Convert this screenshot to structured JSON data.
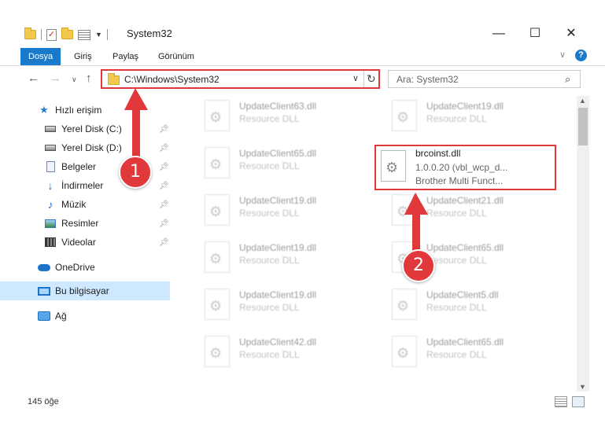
{
  "window": {
    "title": "System32",
    "minimize": "—",
    "maximize": "☐",
    "close": "✕"
  },
  "ribbon": {
    "tabs": [
      "Dosya",
      "Giriş",
      "Paylaş",
      "Görünüm"
    ],
    "active_tab": "Dosya",
    "help": "?"
  },
  "address": {
    "path": "C:\\Windows\\System32",
    "search_placeholder": "Ara: System32"
  },
  "sidebar": {
    "quick_access": "Hızlı erişim",
    "items": [
      {
        "label": "Yerel Disk (C:)",
        "icon": "drive-icon"
      },
      {
        "label": "Yerel Disk (D:)",
        "icon": "drive-icon"
      },
      {
        "label": "Belgeler",
        "icon": "documents-icon"
      },
      {
        "label": "İndirmeler",
        "icon": "downloads-icon"
      },
      {
        "label": "Müzik",
        "icon": "music-icon"
      },
      {
        "label": "Resimler",
        "icon": "pictures-icon"
      },
      {
        "label": "Videolar",
        "icon": "videos-icon"
      }
    ],
    "onedrive": "OneDrive",
    "this_pc": "Bu bilgisayar",
    "network": "Ağ"
  },
  "files": {
    "left_column": [
      {
        "name": "UpdateClient63.dll",
        "type": "Resource DLL"
      },
      {
        "name": "UpdateClient65.dll",
        "type": "Resource DLL"
      },
      {
        "name": "UpdateClient19.dll",
        "type": "Resource DLL"
      },
      {
        "name": "UpdateClient19.dll",
        "type": "Resource DLL"
      },
      {
        "name": "UpdateClient19.dll",
        "type": "Resource DLL"
      },
      {
        "name": "UpdateClient42.dll",
        "type": "Resource DLL"
      }
    ],
    "right_column": [
      {
        "name": "UpdateClient19.dll",
        "type": "Resource DLL"
      },
      {
        "name": "brcoinst.dll",
        "version": "1.0.0.20 (vbl_wcp_d...",
        "type": "Brother Multi Funct..."
      },
      {
        "name": "UpdateClient21.dll",
        "type": "Resource DLL"
      },
      {
        "name": "UpdateClient65.dll",
        "type": "Resource DLL"
      },
      {
        "name": "UpdateClient5.dll",
        "type": "Resource DLL"
      },
      {
        "name": "UpdateClient65.dll",
        "type": "Resource DLL"
      }
    ]
  },
  "status": {
    "item_count": "145 öğe"
  },
  "annotations": {
    "step1": "1",
    "step2": "2",
    "color": "#e0383b"
  }
}
